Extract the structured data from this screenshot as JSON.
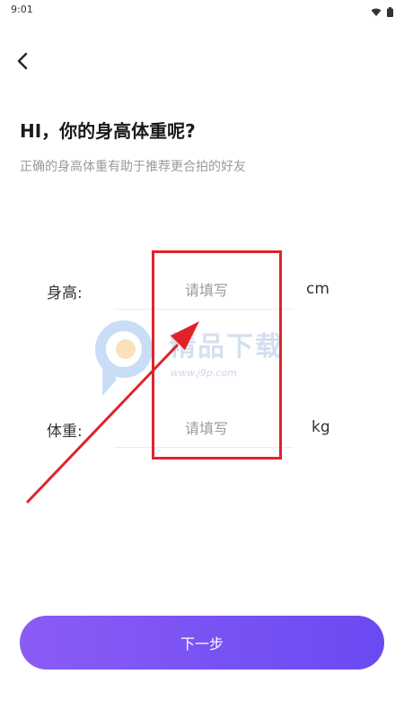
{
  "status_bar": {
    "time": "9:01"
  },
  "header": {
    "title": "HI，你的身高体重呢?",
    "subtitle": "正确的身高体重有助于推荐更合拍的好友"
  },
  "form": {
    "height": {
      "label": "身高:",
      "placeholder": "请填写",
      "value": "",
      "unit": "cm"
    },
    "weight": {
      "label": "体重:",
      "placeholder": "请填写",
      "value": "",
      "unit": "kg"
    }
  },
  "watermark": {
    "text": "精品下载",
    "url": "www.j9p.com"
  },
  "footer": {
    "next_label": "下一步"
  },
  "colors": {
    "accent_start": "#8a5cf6",
    "accent_end": "#6b4af2",
    "annotation_red": "#e0232b"
  },
  "icons": [
    "wifi-icon",
    "battery-icon",
    "back-arrow-icon",
    "watermark-logo-icon"
  ]
}
